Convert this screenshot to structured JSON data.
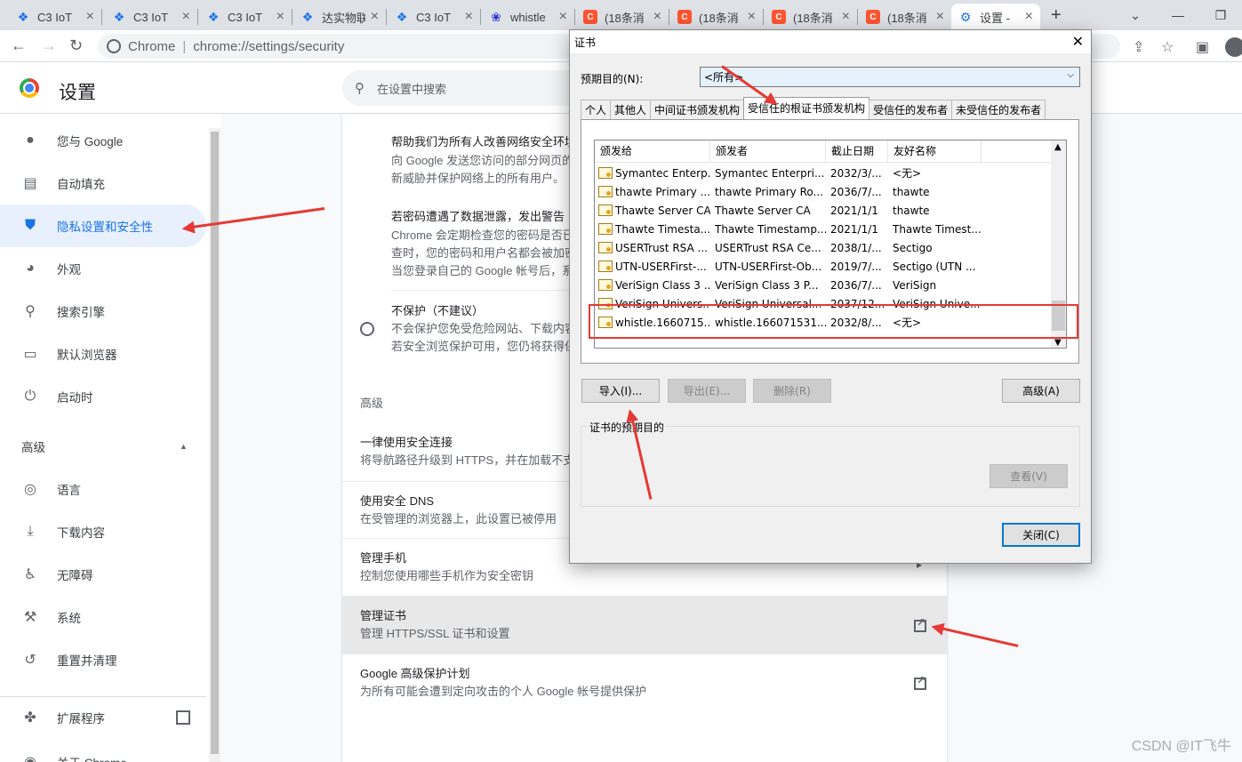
{
  "tabs": [
    {
      "title": "C3 IoT",
      "icon": "c3-icon",
      "color": "#1a73e8"
    },
    {
      "title": "C3 IoT",
      "icon": "c3-icon",
      "color": "#1a73e8"
    },
    {
      "title": "C3 IoT",
      "icon": "c3-icon",
      "color": "#1a73e8"
    },
    {
      "title": "达实物联",
      "icon": "c3-icon",
      "color": "#1a73e8"
    },
    {
      "title": "C3 IoT",
      "icon": "c3-icon",
      "color": "#1a73e8"
    },
    {
      "title": "whistle",
      "icon": "paw-icon",
      "color": "#2932e1"
    },
    {
      "title": "(18条消",
      "icon": "csdn-icon",
      "color": "#fc5531"
    },
    {
      "title": "(18条消",
      "icon": "csdn-icon",
      "color": "#fc5531"
    },
    {
      "title": "(18条消",
      "icon": "csdn-icon",
      "color": "#fc5531"
    },
    {
      "title": "(18条消",
      "icon": "csdn-icon",
      "color": "#fc5531"
    },
    {
      "title": "设置 - ",
      "icon": "gear-icon",
      "color": "#1a73e8"
    }
  ],
  "omnibox": {
    "brand": "Chrome",
    "url": "chrome://settings/security"
  },
  "header": {
    "title": "设置",
    "search_placeholder": "在设置中搜索"
  },
  "sidebar": {
    "items": [
      {
        "label": "您与 Google",
        "icon": "person-icon"
      },
      {
        "label": "自动填充",
        "icon": "clipboard-icon"
      },
      {
        "label": "隐私设置和安全性",
        "icon": "shield-icon"
      },
      {
        "label": "外观",
        "icon": "palette-icon"
      },
      {
        "label": "搜索引擎",
        "icon": "search-icon"
      },
      {
        "label": "默认浏览器",
        "icon": "browser-icon"
      },
      {
        "label": "启动时",
        "icon": "power-icon"
      }
    ],
    "advanced_label": "高级",
    "advanced_items": [
      {
        "label": "语言",
        "icon": "globe-icon"
      },
      {
        "label": "下载内容",
        "icon": "download-icon"
      },
      {
        "label": "无障碍",
        "icon": "accessibility-icon"
      },
      {
        "label": "系统",
        "icon": "wrench-icon"
      },
      {
        "label": "重置并清理",
        "icon": "restore-icon"
      }
    ],
    "extensions": "扩展程序",
    "about": "关于 Chrome"
  },
  "main": {
    "help_lines": [
      "帮助我们为所有人改善网络安全环境",
      "向 Google 发送您访问的部分网页的",
      "新威胁并保护网络上的所有用户。"
    ],
    "pw_title": "若密码遭遇了数据泄露，发出警告",
    "pw_lines": [
      "Chrome 会定期检查您的密码是否已",
      "查时，您的密码和用户名都会被加密",
      "当您登录自己的 Google 帐号后，系"
    ],
    "noprot_title": "不保护（不建议）",
    "noprot_lines": [
      "不会保护您免受危险网站、下载内容",
      "若安全浏览保护可用，您仍将获得保"
    ],
    "advanced_heading": "高级",
    "https_title": "一律使用安全连接",
    "https_sub": "将导航路径升级到 HTTPS，并在加载不支",
    "dns_title": "使用安全 DNS",
    "dns_sub": "在受管理的浏览器上，此设置已被停用",
    "phone_title": "管理手机",
    "phone_sub": "控制您使用哪些手机作为安全密钥",
    "cert_title": "管理证书",
    "cert_sub": "管理 HTTPS/SSL 证书和设置",
    "gapp_title": "Google 高级保护计划",
    "gapp_sub": "为所有可能会遭到定向攻击的个人 Google 帐号提供保护"
  },
  "dialog": {
    "title": "证书",
    "purpose_label": "预期目的(N):",
    "purpose_value": "<所有>",
    "tabs": [
      "个人",
      "其他人",
      "中间证书颁发机构",
      "受信任的根证书颁发机构",
      "受信任的发布者",
      "未受信任的发布者"
    ],
    "active_tab": 3,
    "columns": [
      "颁发给",
      "颁发者",
      "截止日期",
      "友好名称"
    ],
    "rows": [
      [
        "Symantec Enterp...",
        "Symantec Enterpri...",
        "2032/3/...",
        "<无>"
      ],
      [
        "thawte Primary ...",
        "thawte Primary Ro...",
        "2036/7/...",
        "thawte"
      ],
      [
        "Thawte Server CA",
        "Thawte Server CA",
        "2021/1/1",
        "thawte"
      ],
      [
        "Thawte Timesta...",
        "Thawte Timestamp...",
        "2021/1/1",
        "Thawte Timest..."
      ],
      [
        "USERTrust RSA ...",
        "USERTrust RSA Ce...",
        "2038/1/...",
        "Sectigo"
      ],
      [
        "UTN-USERFirst-...",
        "UTN-USERFirst-Ob...",
        "2019/7/...",
        "Sectigo (UTN ..."
      ],
      [
        "VeriSign Class 3 ...",
        "VeriSign Class 3 P...",
        "2036/7/...",
        "VeriSign"
      ],
      [
        "VeriSign Univers...",
        "VeriSign Universal...",
        "2037/12...",
        "VeriSign Unive..."
      ],
      [
        "whistle.1660715...",
        "whistle.166071531...",
        "2032/8/...",
        "<无>"
      ]
    ],
    "buttons": {
      "import": "导入(I)...",
      "export": "导出(E)...",
      "remove": "删除(R)",
      "advanced": "高级(A)",
      "view": "查看(V)",
      "close": "关闭(C)"
    },
    "group_label": "证书的预期目的"
  },
  "watermark": "CSDN @IT飞牛",
  "colors": {
    "accent": "#1a73e8",
    "annotation": "#e53935"
  }
}
